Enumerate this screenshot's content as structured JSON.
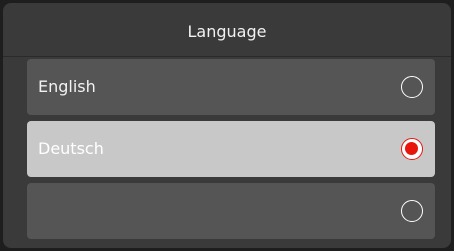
{
  "dialog": {
    "title": "Language"
  },
  "options": [
    {
      "label": "English",
      "selected": false
    },
    {
      "label": "Deutsch",
      "selected": true
    },
    {
      "label": "",
      "selected": false
    }
  ],
  "colors": {
    "accent": "#e8150d",
    "background": "#3a3a3a",
    "option_background": "#555555",
    "selected_background": "#c8c8c8"
  }
}
